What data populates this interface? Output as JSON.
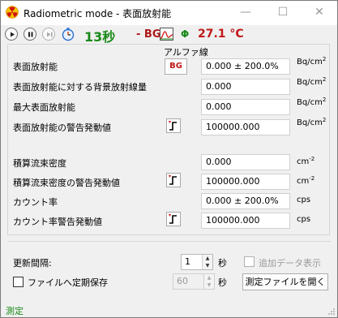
{
  "window": {
    "title": "Radiometric mode - 表面放射能",
    "minimize_glyph": "—",
    "maximize_glyph": "☐",
    "close_glyph": "✕"
  },
  "toolbar": {
    "elapsed": "13秒",
    "bg_indicator": "- BG",
    "phi": "Φ",
    "temperature": "27.1 °C",
    "colors": {
      "time": "#1a8a1a",
      "bg": "#b01818",
      "temp": "#c01818"
    }
  },
  "panel": {
    "column_header": "アルファ線",
    "bg_button_label": "BG",
    "rows": [
      {
        "label": "表面放射能",
        "value": "0.000 ± 200.0%",
        "unit": "Bq/cm",
        "unit_sup": "2"
      },
      {
        "label": "表面放射能に対する背景放射線量",
        "value": "0.000",
        "unit": "Bq/cm",
        "unit_sup": "2"
      },
      {
        "label": "最大表面放射能",
        "value": "0.000",
        "unit": "Bq/cm",
        "unit_sup": "2"
      },
      {
        "label": "表面放射能の警告発動値",
        "value": "100000.000",
        "unit": "Bq/cm",
        "unit_sup": "2"
      },
      {
        "label": "積算流束密度",
        "value": "0.000",
        "unit": "cm",
        "unit_sup": "-2"
      },
      {
        "label": "積算流束密度の警告発動値",
        "value": "100000.000",
        "unit": "cm",
        "unit_sup": "-2"
      },
      {
        "label": "カウント率",
        "value": "0.000 ± 200.0%",
        "unit": "cps",
        "unit_sup": ""
      },
      {
        "label": "カウント率警告発動値",
        "value": "100000.000",
        "unit": "cps",
        "unit_sup": ""
      }
    ]
  },
  "bottom": {
    "update_interval_label": "更新間隔:",
    "update_interval_value": "1",
    "seconds_unit": "秒",
    "append_data_label": "追加データ表示",
    "periodic_save_label": "ファイルへ定期保存",
    "save_interval_value": "60",
    "open_file_button": "測定ファイルを開く"
  },
  "status": {
    "text": "測定"
  }
}
